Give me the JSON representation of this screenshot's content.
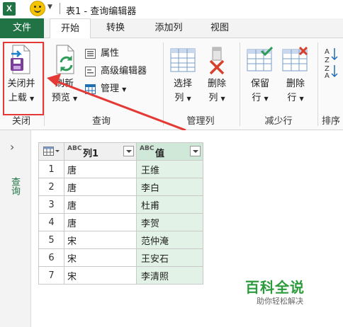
{
  "window": {
    "title": "表1 - 查询编辑器",
    "app_badge": "X"
  },
  "tabs": [
    {
      "label": "文件"
    },
    {
      "label": "开始"
    },
    {
      "label": "转换"
    },
    {
      "label": "添加列"
    },
    {
      "label": "视图"
    }
  ],
  "ribbon": {
    "close_group": {
      "button_line1": "关闭并",
      "button_line2": "上载",
      "group_label": "关闭"
    },
    "query_group": {
      "refresh_line1": "刷新",
      "refresh_line2": "预览",
      "properties": "属性",
      "advanced_editor": "高级编辑器",
      "manage": "管理",
      "group_label": "查询"
    },
    "manage_columns": {
      "choose_line1": "选择",
      "choose_line2": "列",
      "remove_line1": "删除",
      "remove_line2": "列",
      "group_label": "管理列"
    },
    "reduce_rows": {
      "keep_line1": "保留",
      "keep_line2": "行",
      "remove_line1": "删除",
      "remove_line2": "行",
      "group_label": "减少行"
    },
    "sort": {
      "group_label": "排序"
    }
  },
  "side_panel": {
    "label": "查询"
  },
  "table": {
    "columns": [
      {
        "type_badge": "ABC",
        "name": "列1"
      },
      {
        "type_badge": "ABC",
        "name": "值"
      }
    ],
    "rows": [
      {
        "n": "1",
        "c1": "唐",
        "c2": "王维"
      },
      {
        "n": "2",
        "c1": "唐",
        "c2": "李白"
      },
      {
        "n": "3",
        "c1": "唐",
        "c2": "杜甫"
      },
      {
        "n": "4",
        "c1": "唐",
        "c2": "李贺"
      },
      {
        "n": "5",
        "c1": "宋",
        "c2": "范仲淹"
      },
      {
        "n": "6",
        "c1": "宋",
        "c2": "王安石"
      },
      {
        "n": "7",
        "c1": "宋",
        "c2": "李清照"
      }
    ]
  },
  "watermark": {
    "main": "百科全说",
    "sub": "助你轻松解决"
  },
  "colors": {
    "excel_green": "#217346",
    "selected_column": "#e2f2e6",
    "annotation_red": "#e53935"
  }
}
